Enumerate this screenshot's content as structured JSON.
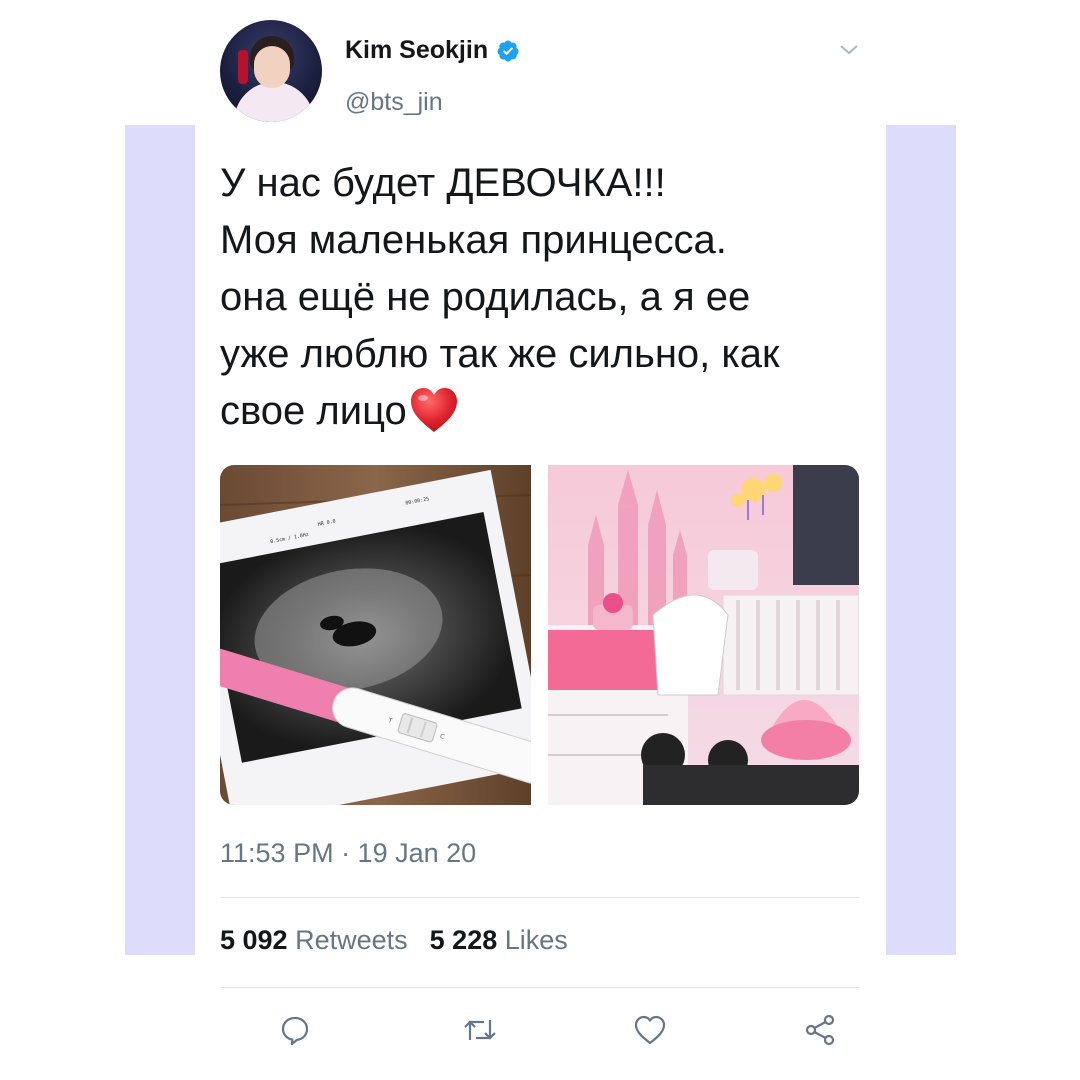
{
  "tweet": {
    "author_name": "Kim Seokjin",
    "author_handle": "@bts_jin",
    "text_lines": [
      "У нас будет ДЕВОЧКА!!!",
      "Моя маленькая принцесса.",
      "она ещё не родилась, а я ее",
      "уже люблю так же сильно, как",
      "свое лицо"
    ],
    "timestamp": "11:53 PM · 19 Jan 20",
    "retweets_count": "5 092",
    "retweets_label": "Retweets",
    "likes_count": "5 228",
    "likes_label": "Likes"
  },
  "icons": {
    "verified": "verified-badge-icon",
    "caret": "chevron-down-icon",
    "reply": "reply-icon",
    "retweet": "retweet-icon",
    "like": "like-icon",
    "share": "share-icon"
  },
  "colors": {
    "verified_blue": "#1da1f2",
    "icon_gray": "#657786",
    "text": "#14171a",
    "side_bands": "#dedcfb",
    "heart_red": "#e0242f"
  }
}
